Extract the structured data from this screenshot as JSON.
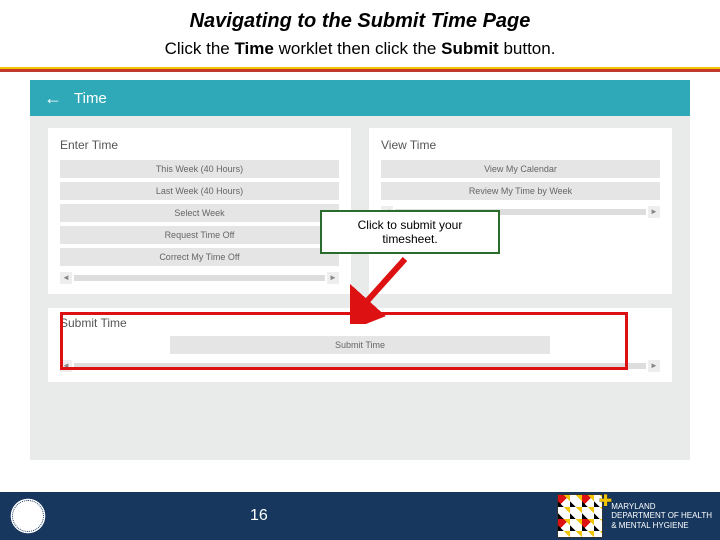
{
  "title": "Navigating to the Submit Time Page",
  "subtitle_pre": "Click the ",
  "subtitle_b1": "Time",
  "subtitle_mid": " worklet then click the ",
  "subtitle_b2": "Submit",
  "subtitle_post": " button.",
  "topbar": {
    "back": "←",
    "title": "Time"
  },
  "enter": {
    "title": "Enter Time",
    "rows": [
      "This Week (40 Hours)",
      "Last Week (40 Hours)",
      "Select Week",
      "Request Time Off",
      "Correct My Time Off"
    ]
  },
  "view": {
    "title": "View Time",
    "rows": [
      "View My Calendar",
      "Review My Time by Week"
    ]
  },
  "submit": {
    "title": "Submit Time",
    "button": "Submit Time"
  },
  "callout": {
    "line1": "Click to submit your",
    "line2": "timesheet."
  },
  "scroll": {
    "left": "◄",
    "right": "►"
  },
  "footer": {
    "page": "16",
    "dept1": "MARYLAND",
    "dept2": "DEPARTMENT OF HEALTH",
    "dept3": "& MENTAL HYGIENE"
  }
}
